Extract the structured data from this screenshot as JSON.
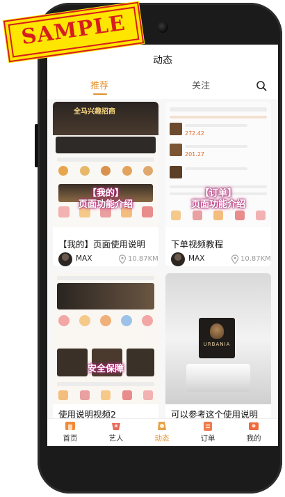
{
  "watermark": "SAMPLE",
  "header": {
    "title": "动态"
  },
  "tabs": [
    {
      "label": "推荐",
      "active": true
    },
    {
      "label": "关注",
      "active": false
    }
  ],
  "feed": [
    {
      "title": "【我的】页面使用说明",
      "author": "MAX",
      "distance": "10.87KM",
      "overlay": [
        "【我的】",
        "页面功能介绍"
      ],
      "banner": [
        "全马兴趣招商"
      ]
    },
    {
      "title": "下单视频教程",
      "author": "MAX",
      "distance": "10.87KM",
      "overlay": [
        "【订单】",
        "页面功能介绍"
      ],
      "prices": [
        "272.42",
        "201.27"
      ]
    },
    {
      "title": "使用说明视频2",
      "overlay": [
        "安全保障"
      ]
    },
    {
      "title": "可以参考这个使用说明",
      "logo": "URBANIA"
    }
  ],
  "bottom_nav": [
    {
      "label": "首页",
      "icon": "home-icon",
      "active": false
    },
    {
      "label": "艺人",
      "icon": "artist-icon",
      "active": false
    },
    {
      "label": "动态",
      "icon": "moments-icon",
      "active": true
    },
    {
      "label": "订单",
      "icon": "order-icon",
      "active": false
    },
    {
      "label": "我的",
      "icon": "profile-icon",
      "active": false
    }
  ],
  "colors": {
    "accent": "#e0922e",
    "stamp": "#d61e1e",
    "stamp_bg": "#ffe600"
  }
}
